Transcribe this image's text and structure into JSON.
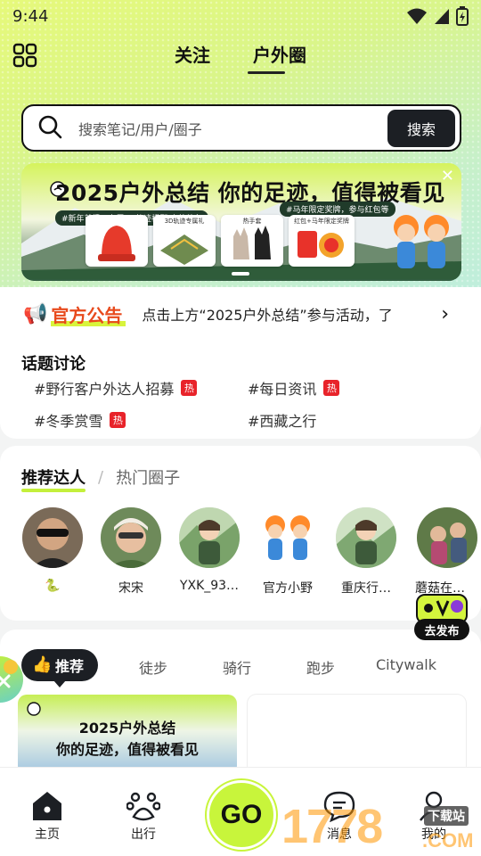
{
  "status_bar": {
    "time": "9:44"
  },
  "header": {
    "tabs": [
      {
        "label": "关注"
      },
      {
        "label": "户外圈"
      }
    ],
    "active_tab": "户外圈"
  },
  "search": {
    "placeholder": "搜索笔记/用户/圈子",
    "button_label": "搜索"
  },
  "banner": {
    "title": "2025户外总结 你的足迹，值得被看见",
    "pill_left": "#新年首播：专属3D轨迹模型·户外装备",
    "pill_right": "#马年限定奖牌，参与红包等",
    "tile_labels": [
      "3D轨迹专属礼",
      "热手套",
      "红包+马年限定奖牌"
    ]
  },
  "notice": {
    "label": "官方公告",
    "text": "点击上方“2025户外总结”参与活动，了"
  },
  "topics": {
    "title": "话题讨论",
    "items": [
      {
        "label": "#野行客户外达人招募",
        "hot": "热"
      },
      {
        "label": "#每日资讯",
        "hot": "热"
      },
      {
        "label": "#冬季赏雪",
        "hot": "热"
      },
      {
        "label": "#西藏之行",
        "hot": ""
      }
    ]
  },
  "people": {
    "tab_active": "推荐达人",
    "tab_inactive": "热门圈子",
    "items": [
      {
        "name": "🐍"
      },
      {
        "name": "宋宋"
      },
      {
        "name": "YXK_93…"
      },
      {
        "name": "官方小野"
      },
      {
        "name": "重庆行…"
      },
      {
        "name": "蘑菇在…"
      }
    ]
  },
  "post_fab": {
    "label": "去发布"
  },
  "feed": {
    "tabs": [
      {
        "label": "推荐"
      },
      {
        "label": "徒步"
      },
      {
        "label": "骑行"
      },
      {
        "label": "跑步"
      },
      {
        "label": "Citywalk"
      }
    ],
    "card_title_1": "2025户外总结",
    "card_title_2": "你的足迹，值得被看见"
  },
  "bottom_nav": {
    "items": [
      {
        "label": "主页"
      },
      {
        "label": "出行"
      },
      {
        "label": "GO"
      },
      {
        "label": "消息"
      },
      {
        "label": "我的"
      }
    ]
  },
  "watermark": {
    "main": "1778",
    "small": "下载站",
    "com": ".COM"
  },
  "colors": {
    "accent_lime": "#c8f53b",
    "dark": "#1c1f24",
    "hot_red": "#e8232a",
    "notice_orange": "#e8491c"
  }
}
